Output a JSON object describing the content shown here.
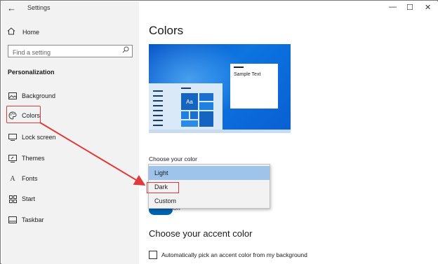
{
  "window": {
    "title": "Settings",
    "controls": {
      "minimize": "—",
      "maximize": "☐",
      "close": "✕"
    }
  },
  "sidebar": {
    "home_label": "Home",
    "search_placeholder": "Find a setting",
    "section_title": "Personalization",
    "items": [
      {
        "label": "Background",
        "icon": "image-icon"
      },
      {
        "label": "Colors",
        "icon": "palette-icon"
      },
      {
        "label": "Lock screen",
        "icon": "lock-screen-icon"
      },
      {
        "label": "Themes",
        "icon": "themes-icon"
      },
      {
        "label": "Fonts",
        "icon": "fonts-icon"
      },
      {
        "label": "Start",
        "icon": "start-icon"
      },
      {
        "label": "Taskbar",
        "icon": "taskbar-icon"
      }
    ]
  },
  "main": {
    "title": "Colors",
    "preview": {
      "sample_text": "Sample Text",
      "tile_text": "Aa"
    },
    "choose_color_label": "Choose your color",
    "dropdown": {
      "options": [
        "Light",
        "Dark",
        "Custom"
      ],
      "highlighted": "Light",
      "annotated": "Dark"
    },
    "toggle_state": "On",
    "accent_title": "Choose your accent color",
    "auto_accent_label": "Automatically pick an accent color from my background"
  },
  "colors": {
    "accent": "#0063b1",
    "annotation": "#e03a3a",
    "dropdown_highlight": "#9fc4ec"
  }
}
